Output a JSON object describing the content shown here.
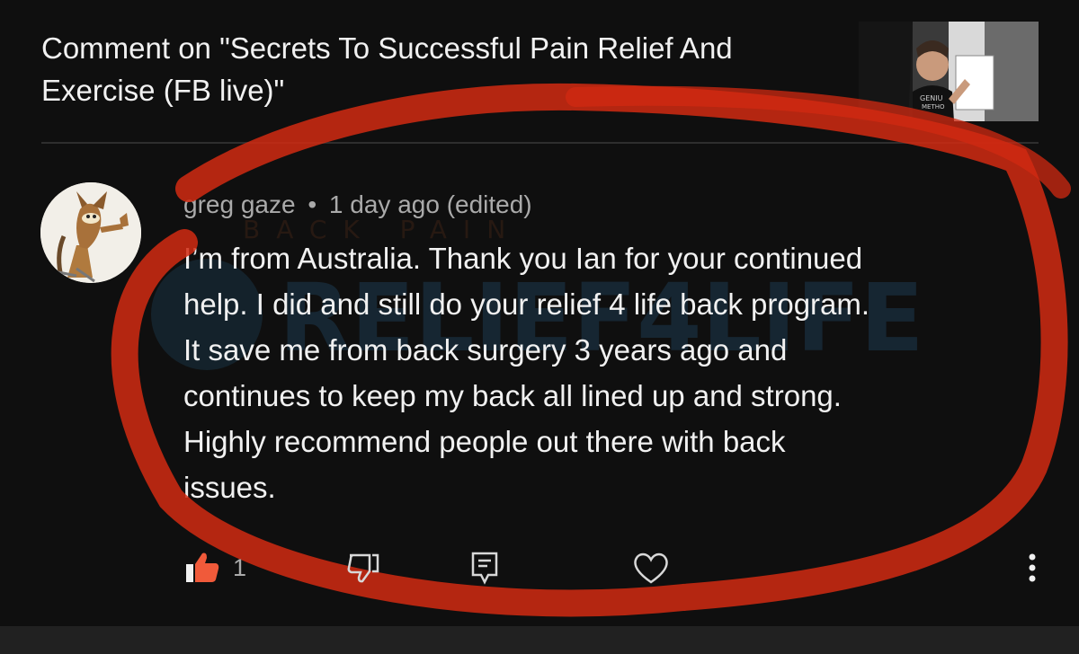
{
  "page": {
    "header_title": "Comment on \"Secrets To Successful Pain Relief And Exercise (FB live)\""
  },
  "thumbnail": {
    "shirt_text": "GENIU\nMETHO"
  },
  "watermark": {
    "top_text": "BACK PAIN",
    "main_text": "RELIEF4LIFE"
  },
  "comment": {
    "author": "greg gaze",
    "separator": "•",
    "timestamp": "1 day ago (edited)",
    "text": "I’m from Australia. Thank you Ian for your continued\nhelp. I did and still do your relief 4 life back program.\nIt save me from back surgery 3 years ago and\ncontinues to keep my back all lined up and strong.\nHighly recommend people out there with back\nissues.",
    "like_count": "1"
  },
  "icons": {
    "like": "thumbs-up-icon",
    "dislike": "thumbs-down-icon",
    "reply": "comment-icon",
    "heart": "heart-icon",
    "more": "more-vertical-icon"
  },
  "colors": {
    "background": "#0f0f0f",
    "text": "#f1f1f1",
    "secondary_text": "#aaaaaa",
    "like_active": "#f05a3a",
    "annotation_red": "#d12a12"
  }
}
